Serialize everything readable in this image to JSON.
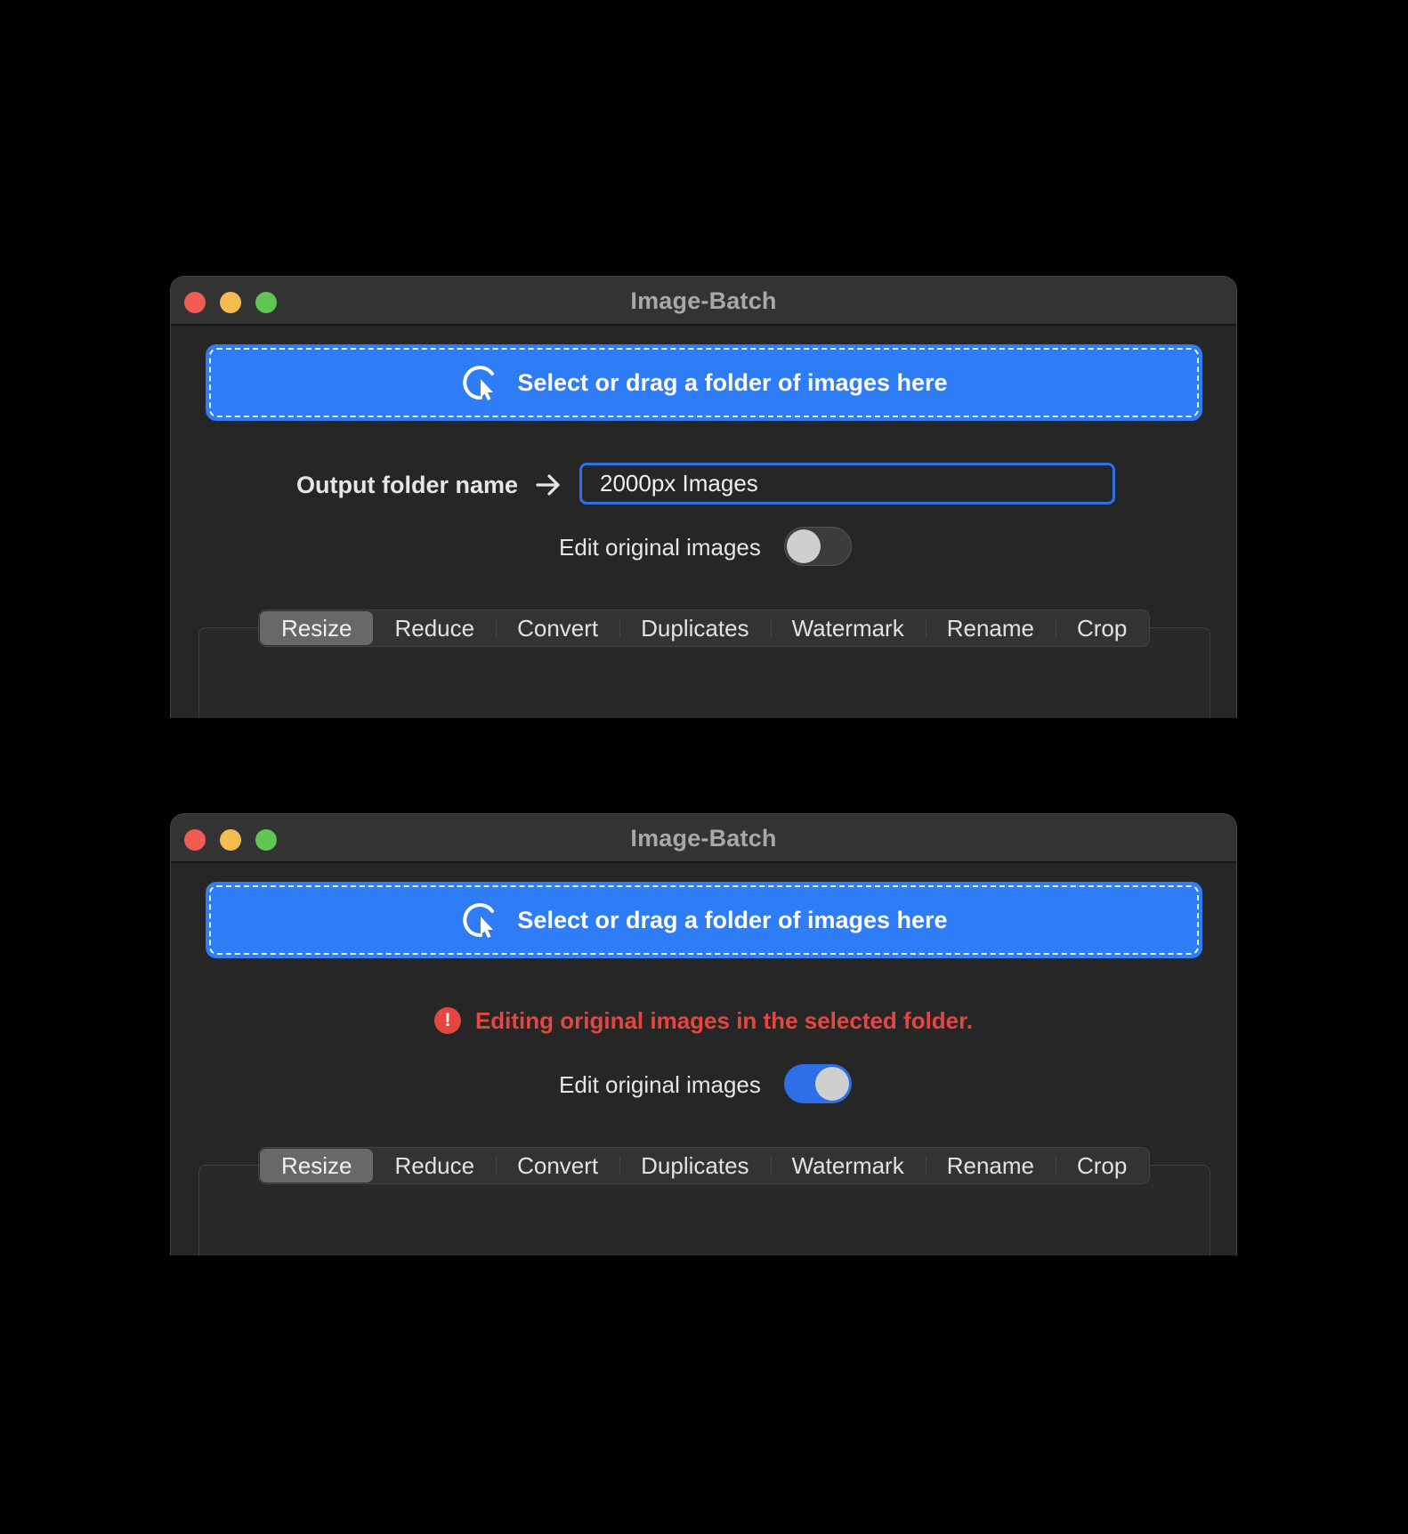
{
  "windows": [
    {
      "title": "Image-Batch",
      "dropzone": {
        "label": "Select or drag a folder of images here"
      },
      "output": {
        "label": "Output folder name",
        "value": "2000px Images"
      },
      "toggle": {
        "label": "Edit original images",
        "state": "off"
      },
      "tabs": [
        "Resize",
        "Reduce",
        "Convert",
        "Duplicates",
        "Watermark",
        "Rename",
        "Crop"
      ],
      "selected_tab": "Resize"
    },
    {
      "title": "Image-Batch",
      "dropzone": {
        "label": "Select or drag a folder of images here"
      },
      "warning": {
        "icon": "!",
        "text": "Editing original images in the selected folder."
      },
      "toggle": {
        "label": "Edit original images",
        "state": "on"
      },
      "tabs": [
        "Resize",
        "Reduce",
        "Convert",
        "Duplicates",
        "Watermark",
        "Rename",
        "Crop"
      ],
      "selected_tab": "Resize"
    }
  ],
  "colors": {
    "accent": "#2e7cf6",
    "warning": "#e5463f",
    "window_bg": "#262626",
    "titlebar_bg": "#333333"
  },
  "icons": {
    "dropzone": "pointer-click-icon",
    "output_arrow": "arrow-right-icon",
    "warning": "exclamation-circle-icon"
  }
}
